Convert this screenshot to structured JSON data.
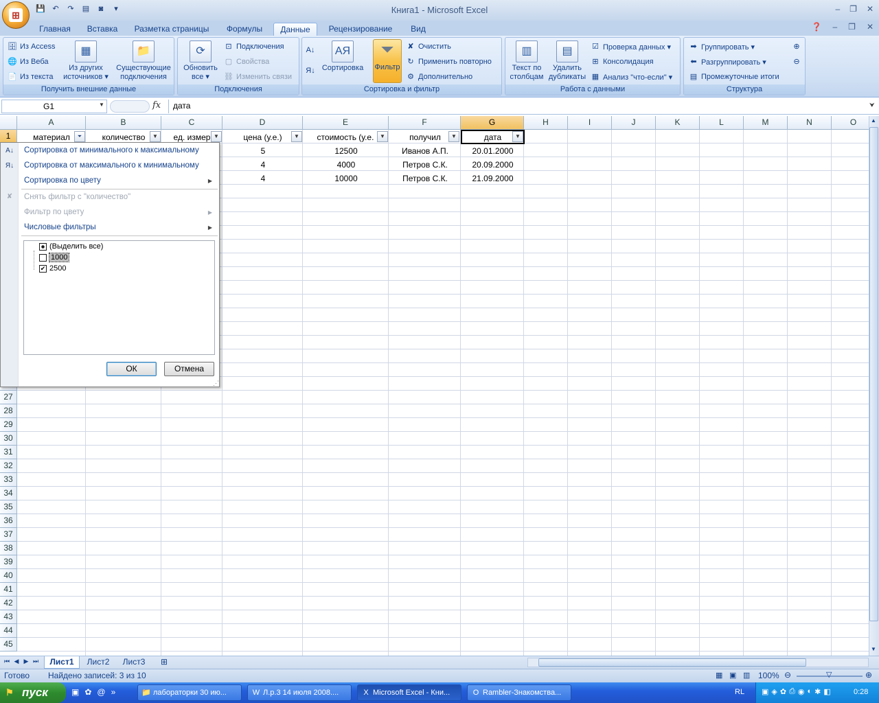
{
  "window": {
    "title": "Книга1 - Microsoft Excel",
    "controls": [
      "–",
      "❐",
      "✕"
    ]
  },
  "ribbon_tabs": [
    "Главная",
    "Вставка",
    "Разметка страницы",
    "Формулы",
    "Данные",
    "Рецензирование",
    "Вид"
  ],
  "ribbon_active_tab": "Данные",
  "ribbon": {
    "external": {
      "label": "Получить внешние данные",
      "from_access": "Из Access",
      "from_web": "Из Веба",
      "from_text": "Из текста",
      "from_other": "Из других источников ▾",
      "existing": "Существующие подключения"
    },
    "connections": {
      "label": "Подключения",
      "refresh": "Обновить все ▾",
      "connections": "Подключения",
      "properties": "Свойства",
      "edit_links": "Изменить связи"
    },
    "sort_filter": {
      "label": "Сортировка и фильтр",
      "sort": "Сортировка",
      "filter": "Фильтр",
      "clear": "Очистить",
      "reapply": "Применить повторно",
      "advanced": "Дополнительно"
    },
    "data_tools": {
      "label": "Работа с данными",
      "text_to_columns": "Текст по столбцам",
      "remove_duplicates": "Удалить дубликаты",
      "validation": "Проверка данных ▾",
      "consolidate": "Консолидация",
      "whatif": "Анализ \"что-если\" ▾"
    },
    "outline": {
      "label": "Структура",
      "group": "Группировать ▾",
      "ungroup": "Разгруппировать ▾",
      "subtotal": "Промежуточные итоги"
    }
  },
  "formula_bar": {
    "name_box": "G1",
    "fx": "fx",
    "formula": "дата"
  },
  "columns": [
    "A",
    "B",
    "C",
    "D",
    "E",
    "F",
    "G",
    "H",
    "I",
    "J",
    "K",
    "L",
    "M",
    "N",
    "O"
  ],
  "visible_rows_top": [
    "1"
  ],
  "visible_rows_bottom": [
    "27",
    "28",
    "29",
    "30",
    "31",
    "32",
    "33",
    "34",
    "35",
    "36",
    "37",
    "38",
    "39",
    "40",
    "41",
    "42",
    "43",
    "44",
    "45"
  ],
  "sheet": {
    "headers": [
      "материал",
      "количество",
      "ед. измер",
      "цена (у.е.)",
      "стоимость (у.е.",
      "получил",
      "дата"
    ],
    "rows": [
      {
        "D": "5",
        "E": "12500",
        "F": "Иванов А.П.",
        "G": "20.01.2000"
      },
      {
        "D": "4",
        "E": "4000",
        "F": "Петров С.К.",
        "G": "20.09.2000"
      },
      {
        "D": "4",
        "E": "10000",
        "F": "Петров С.К.",
        "G": "21.09.2000"
      }
    ]
  },
  "filter_menu": {
    "sort_asc": "Сортировка от минимального к максимальному",
    "sort_desc": "Сортировка от максимального к минимальному",
    "sort_color": "Сортировка по цвету",
    "clear_filter": "Снять фильтр с \"количество\"",
    "filter_color": "Фильтр по цвету",
    "number_filters": "Числовые фильтры",
    "items": [
      {
        "label": "(Выделить все)",
        "state": "mixed"
      },
      {
        "label": "1000",
        "state": "unchecked"
      },
      {
        "label": "2500",
        "state": "checked"
      }
    ],
    "ok": "ОК",
    "cancel": "Отмена"
  },
  "sheet_tabs": [
    "Лист1",
    "Лист2",
    "Лист3"
  ],
  "active_sheet": "Лист1",
  "status": {
    "ready": "Готово",
    "found": "Найдено записей: 3 из 10",
    "zoom": "100%"
  },
  "taskbar": {
    "start": "пуск",
    "buttons": [
      "лабораторки 30 ию...",
      "Л.р.3 14 июля 2008....",
      "Microsoft Excel - Кни...",
      "Rambler-Знакомства..."
    ],
    "lang": "RL",
    "clock": "0:28"
  },
  "colors": {
    "ribbon_bg": "#d0e0f4",
    "selected_header": "#f1c15f",
    "taskbar": "#245edb",
    "start": "#2e8b2e"
  }
}
